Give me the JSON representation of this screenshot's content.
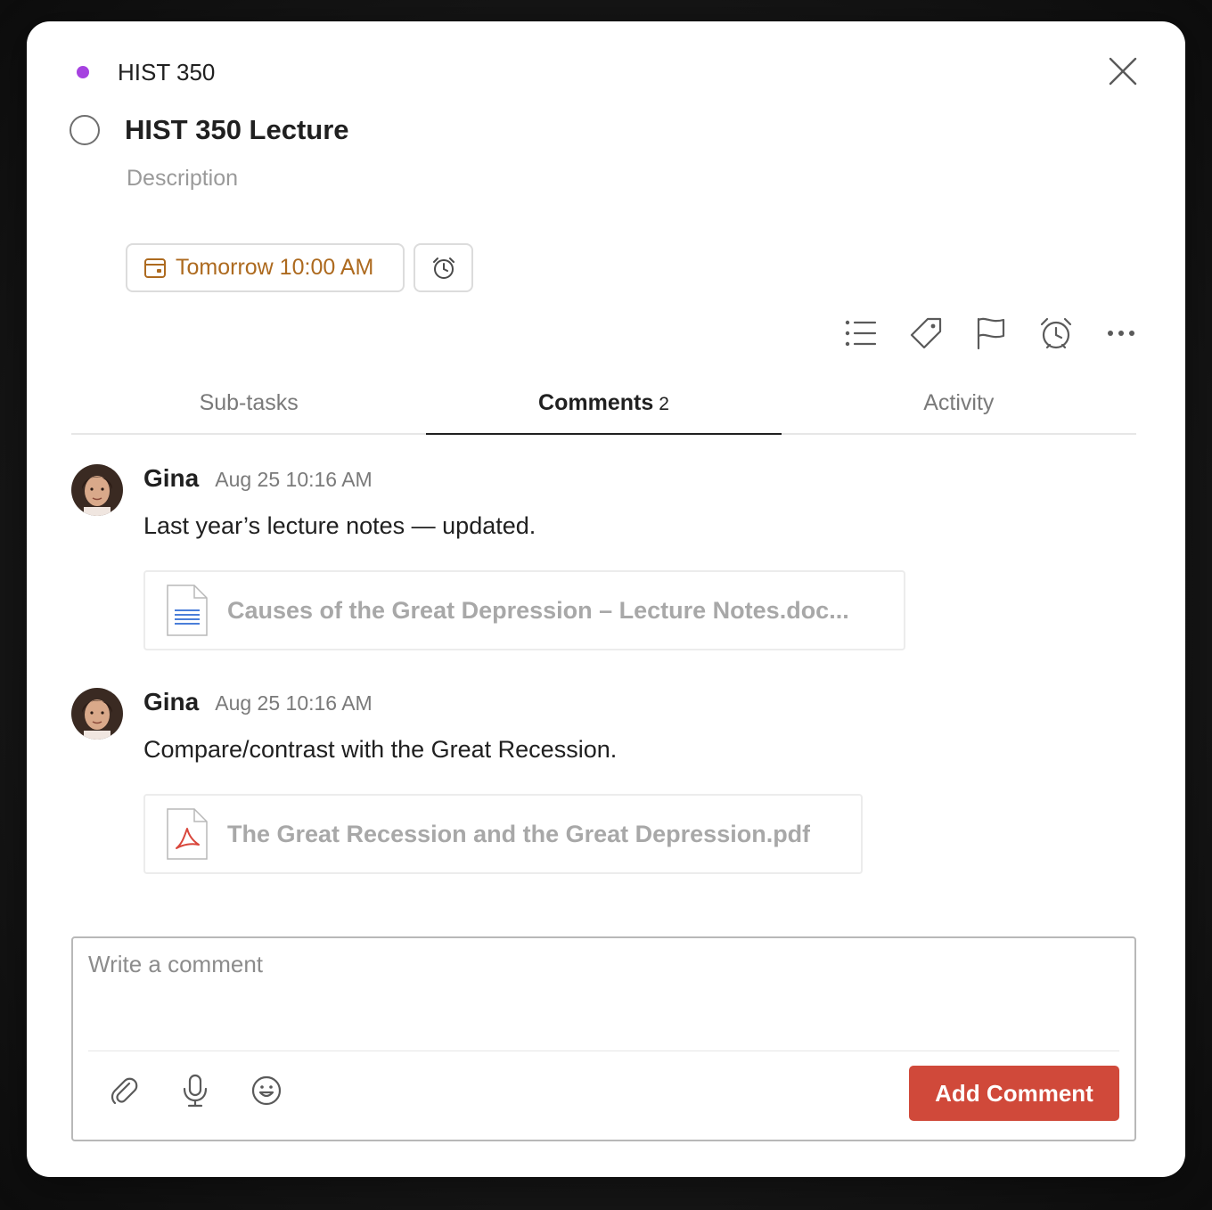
{
  "colors": {
    "project_dot": "#a642e0",
    "accent_date": "#ad6a1f",
    "add_button": "#d0493a",
    "icon_gray": "#6b6b6b",
    "doc_blue": "#4a7ed9",
    "pdf_red": "#d9463b"
  },
  "header": {
    "project": "HIST 350",
    "title": "HIST 350 Lecture",
    "description_placeholder": "Description"
  },
  "chips": {
    "date_label": "Tomorrow 10:00 AM",
    "date_icon": "calendar-icon",
    "reminder_icon": "alarm-clock-icon"
  },
  "toolbar": {
    "icons": [
      "subtasks-list-icon",
      "label-tag-icon",
      "priority-flag-icon",
      "reminder-alarm-icon",
      "more-ellipsis-icon"
    ]
  },
  "tabs": {
    "subtasks": "Sub-tasks",
    "comments": "Comments",
    "comments_count": "2",
    "activity": "Activity"
  },
  "comments": [
    {
      "author": "Gina",
      "timestamp": "Aug 25 10:16 AM",
      "text": "Last year’s lecture notes — updated.",
      "attachment": "Causes of the Great Depression – Lecture Notes.doc...",
      "attachment_icon": "doc-file-icon"
    },
    {
      "author": "Gina",
      "timestamp": "Aug 25 10:16 AM",
      "text": "Compare/contrast with the Great Recession.",
      "attachment": "The Great Recession and the Great Depression.pdf",
      "attachment_icon": "pdf-file-icon"
    }
  ],
  "composer": {
    "placeholder": "Write a comment",
    "value": "",
    "tools": [
      "paperclip-icon",
      "microphone-icon",
      "emoji-smile-icon"
    ],
    "submit_label": "Add Comment"
  }
}
